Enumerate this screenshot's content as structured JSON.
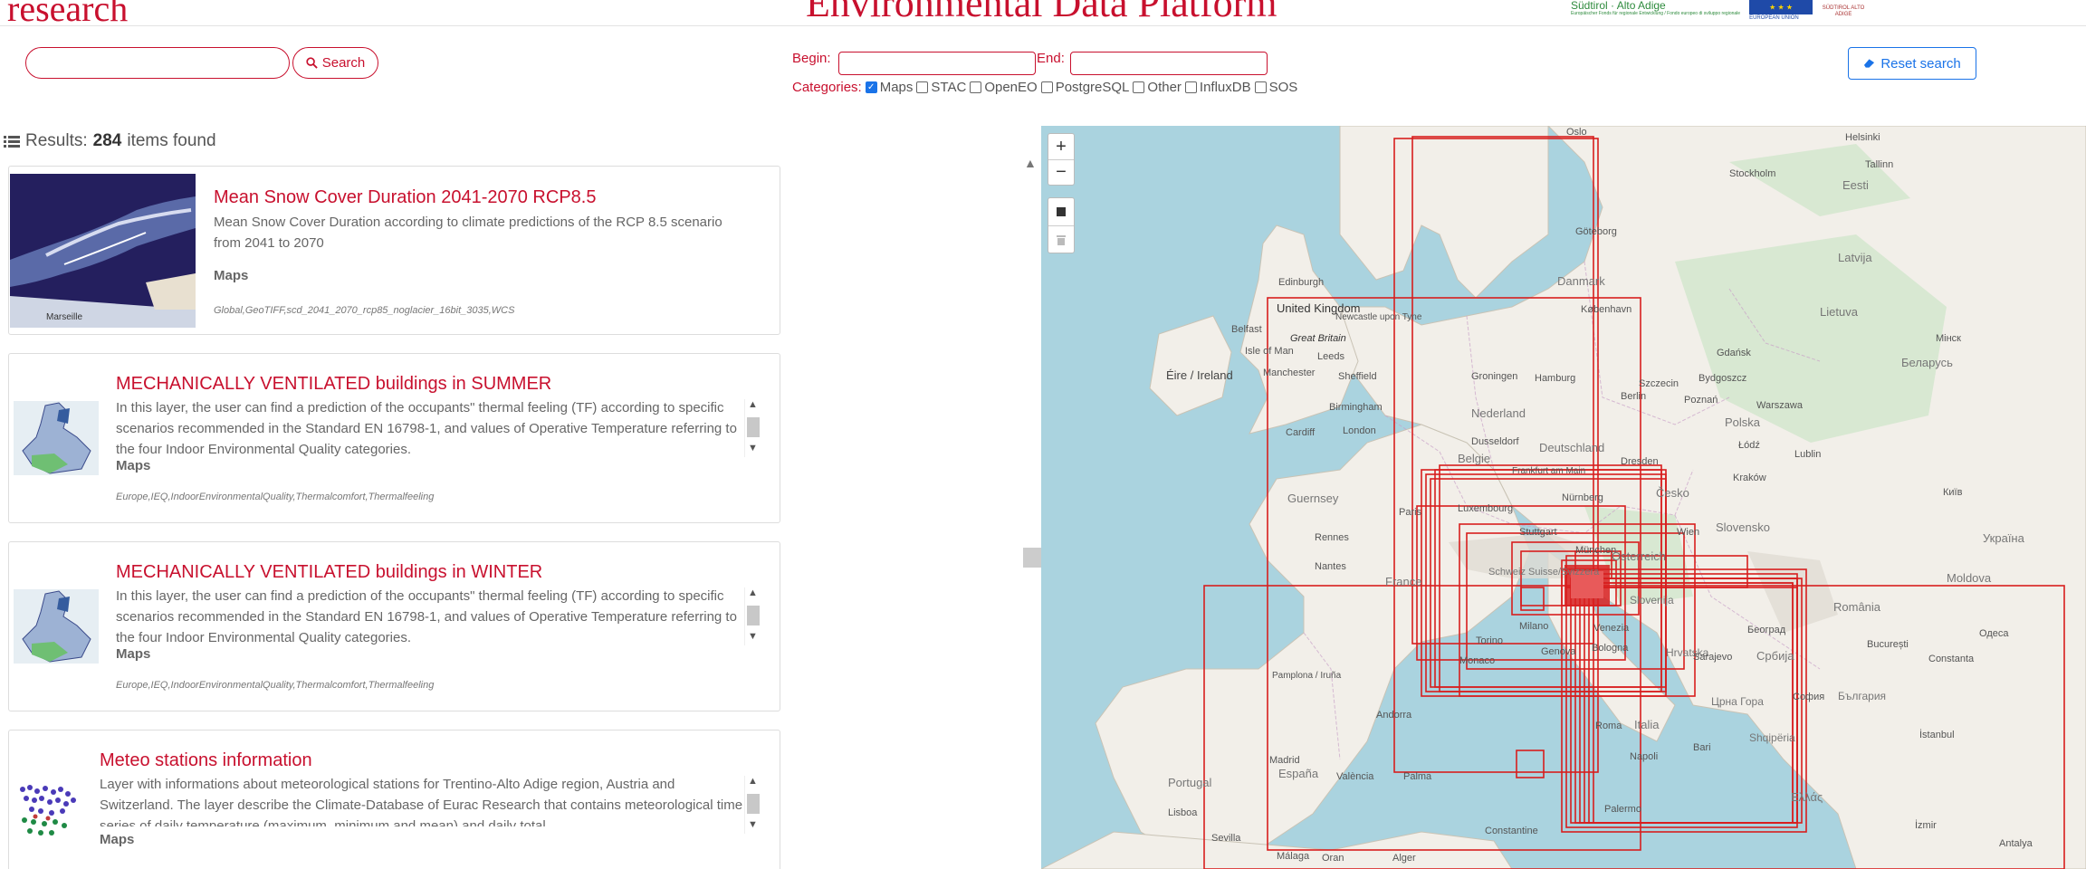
{
  "header": {
    "brand": "research",
    "title": "Environmental Data Platform",
    "logos": {
      "suedtirol": "Südtirol · Alto Adige",
      "suedtirol_sub": "Europäischer Fonds für regionale Entwicklung / Fondo europeo di sviluppo regionale",
      "eu": "EUROPEAN UNION",
      "province": "SÜDTIROL ALTO ADIGE"
    }
  },
  "search": {
    "placeholder": "",
    "button_label": "Search",
    "begin_label": "Begin:",
    "end_label": "End:",
    "categories_label": "Categories:",
    "categories": [
      {
        "label": "Maps",
        "checked": true
      },
      {
        "label": "STAC",
        "checked": false
      },
      {
        "label": "OpenEO",
        "checked": false
      },
      {
        "label": "PostgreSQL",
        "checked": false
      },
      {
        "label": "Other",
        "checked": false
      },
      {
        "label": "InfluxDB",
        "checked": false
      },
      {
        "label": "SOS",
        "checked": false
      }
    ],
    "reset_label": "Reset search"
  },
  "results": {
    "label": "Results:",
    "count": "284",
    "suffix": "items found",
    "items": [
      {
        "title": "Mean Snow Cover Duration 2041-2070 RCP8.5",
        "description": "Mean Snow Cover Duration according to climate predictions of the RCP 8.5 scenario from 2041 to 2070",
        "category": "Maps",
        "tags": "Global,GeoTIFF,scd_2041_2070_rcp85_noglacier_16bit_3035,WCS",
        "thumb_label": "Marseille"
      },
      {
        "title": "MECHANICALLY VENTILATED buildings in SUMMER",
        "description": "In this layer, the user can find a prediction of the occupants\" thermal feeling (TF) according to specific scenarios recommended in the Standard EN 16798-1, and values of Operative Temperature referring to the four Indoor Environmental Quality categories.",
        "category": "Maps",
        "tags": "Europe,IEQ,IndoorEnvironmentalQuality,Thermalcomfort,Thermalfeeling"
      },
      {
        "title": "MECHANICALLY VENTILATED buildings in WINTER",
        "description": "In this layer, the user can find a prediction of the occupants\" thermal feeling (TF) according to specific scenarios recommended in the Standard EN 16798-1, and values of Operative Temperature referring to the four Indoor Environmental Quality categories.",
        "category": "Maps",
        "tags": "Europe,IEQ,IndoorEnvironmentalQuality,Thermalcomfort,Thermalfeeling"
      },
      {
        "title": "Meteo stations information",
        "description": "Layer with informations about meteorological stations for Trentino-Alto Adige region, Austria and Switzerland. The layer describe the Climate-Database of Eurac Research that contains meteorological time series of daily temperature (maximum, minimum and mean) and daily total",
        "category": "Maps"
      }
    ]
  },
  "map": {
    "zoom_in": "+",
    "zoom_out": "−",
    "labels": {
      "oslo": "Oslo",
      "helsinki": "Helsinki",
      "stockholm": "Stockholm",
      "tallinn": "Tallinn",
      "eesti": "Eesti",
      "goteborg": "Göteborg",
      "danmark": "Danmark",
      "latvija": "Latvija",
      "lietuva": "Lietuva",
      "kobenhavn": "København",
      "edinburgh": "Edinburgh",
      "uk": "United Kingdom",
      "newcastle": "Newcastle upon Tyne",
      "great_britain": "Great Britain",
      "belfast": "Belfast",
      "isle_of_man": "Isle of Man",
      "leeds": "Leeds",
      "manchester": "Manchester",
      "sheffield": "Sheffield",
      "eire": "Éire / Ireland",
      "birmingham": "Birmingham",
      "cardiff": "Cardiff",
      "london": "London",
      "groningen": "Groningen",
      "hamburg": "Hamburg",
      "szczecin": "Szczecin",
      "bydgoszcz": "Bydgoszcz",
      "gdansk": "Gdańsk",
      "warszawa": "Warszawa",
      "berlin": "Berlin",
      "poznan": "Poznań",
      "polska": "Polska",
      "nederland": "Nederland",
      "dusseldorf": "Dusseldorf",
      "deutschland": "Deutschland",
      "dresden": "Dresden",
      "belgie": "Belgie",
      "lodz": "Łódź",
      "lublin": "Lublin",
      "krakow": "Kraków",
      "cesko": "Česko",
      "frankfurt": "Frankfurt am Main",
      "luxembourg": "Luxembourg",
      "nurnberg": "Nürnberg",
      "guernsey": "Guernsey",
      "paris": "Paris",
      "rennes": "Rennes",
      "stuttgart": "Stuttgart",
      "munchen": "München",
      "osterreich": "Österreich",
      "wien": "Wien",
      "slovensko": "Slovensko",
      "nantes": "Nantes",
      "france": "France",
      "schweiz": "Schweiz Suisse/Svizzera",
      "slovenija": "Slovenija",
      "moldova": "Moldova",
      "torino": "Torino",
      "milano": "Milano",
      "venezia": "Venezia",
      "hrvatska": "Hrvatska",
      "bologna": "Bologna",
      "genova": "Genova",
      "monaco": "Monaco",
      "srbija": "Србија",
      "beograd": "Београд",
      "romania": "România",
      "bucuresti": "București",
      "constanta": "Constanta",
      "sarajevo": "Sarajevo",
      "crna_gora": "Црна Гора",
      "sofia": "София",
      "balgaria": "България",
      "pampelona": "Pamplona / Iruña",
      "andorra": "Andorra",
      "roma": "Roma",
      "italia": "Italia",
      "napoli": "Napoli",
      "bari": "Bari",
      "shqiperia": "Shqipëria",
      "portugal": "Portugal",
      "madrid": "Madrid",
      "espana": "España",
      "valencia": "València",
      "palma": "Palma",
      "lisboa": "Lisboa",
      "sevilla": "Sevilla",
      "malaga": "Málaga",
      "palermo": "Palermo",
      "ellas": "Ελλάς",
      "istanbul": "İstanbul",
      "izmir": "İzmir",
      "antalya": "Antalya",
      "ukraina": "Україна",
      "kyiv": "Київ",
      "odesa": "Одеса",
      "belarus": "Беларусь",
      "minsk": "Мінск",
      "marseille": "Marseille",
      "constantine": "Constantine",
      "alger": "Alger",
      "oran": "Oran"
    }
  }
}
